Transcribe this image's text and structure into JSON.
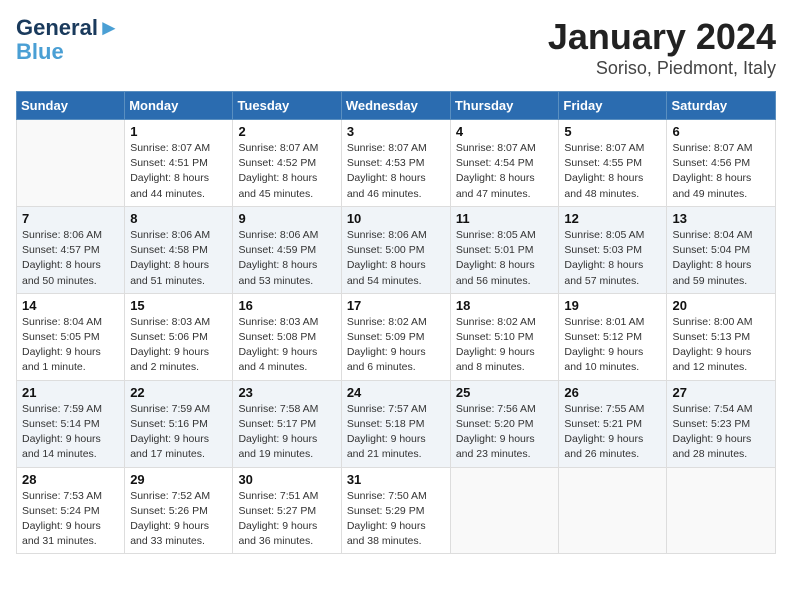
{
  "header": {
    "logo_line1": "General",
    "logo_line2": "Blue",
    "title": "January 2024",
    "subtitle": "Soriso, Piedmont, Italy"
  },
  "weekdays": [
    "Sunday",
    "Monday",
    "Tuesday",
    "Wednesday",
    "Thursday",
    "Friday",
    "Saturday"
  ],
  "weeks": [
    [
      {
        "day": "",
        "info": ""
      },
      {
        "day": "1",
        "info": "Sunrise: 8:07 AM\nSunset: 4:51 PM\nDaylight: 8 hours\nand 44 minutes."
      },
      {
        "day": "2",
        "info": "Sunrise: 8:07 AM\nSunset: 4:52 PM\nDaylight: 8 hours\nand 45 minutes."
      },
      {
        "day": "3",
        "info": "Sunrise: 8:07 AM\nSunset: 4:53 PM\nDaylight: 8 hours\nand 46 minutes."
      },
      {
        "day": "4",
        "info": "Sunrise: 8:07 AM\nSunset: 4:54 PM\nDaylight: 8 hours\nand 47 minutes."
      },
      {
        "day": "5",
        "info": "Sunrise: 8:07 AM\nSunset: 4:55 PM\nDaylight: 8 hours\nand 48 minutes."
      },
      {
        "day": "6",
        "info": "Sunrise: 8:07 AM\nSunset: 4:56 PM\nDaylight: 8 hours\nand 49 minutes."
      }
    ],
    [
      {
        "day": "7",
        "info": "Sunrise: 8:06 AM\nSunset: 4:57 PM\nDaylight: 8 hours\nand 50 minutes."
      },
      {
        "day": "8",
        "info": "Sunrise: 8:06 AM\nSunset: 4:58 PM\nDaylight: 8 hours\nand 51 minutes."
      },
      {
        "day": "9",
        "info": "Sunrise: 8:06 AM\nSunset: 4:59 PM\nDaylight: 8 hours\nand 53 minutes."
      },
      {
        "day": "10",
        "info": "Sunrise: 8:06 AM\nSunset: 5:00 PM\nDaylight: 8 hours\nand 54 minutes."
      },
      {
        "day": "11",
        "info": "Sunrise: 8:05 AM\nSunset: 5:01 PM\nDaylight: 8 hours\nand 56 minutes."
      },
      {
        "day": "12",
        "info": "Sunrise: 8:05 AM\nSunset: 5:03 PM\nDaylight: 8 hours\nand 57 minutes."
      },
      {
        "day": "13",
        "info": "Sunrise: 8:04 AM\nSunset: 5:04 PM\nDaylight: 8 hours\nand 59 minutes."
      }
    ],
    [
      {
        "day": "14",
        "info": "Sunrise: 8:04 AM\nSunset: 5:05 PM\nDaylight: 9 hours\nand 1 minute."
      },
      {
        "day": "15",
        "info": "Sunrise: 8:03 AM\nSunset: 5:06 PM\nDaylight: 9 hours\nand 2 minutes."
      },
      {
        "day": "16",
        "info": "Sunrise: 8:03 AM\nSunset: 5:08 PM\nDaylight: 9 hours\nand 4 minutes."
      },
      {
        "day": "17",
        "info": "Sunrise: 8:02 AM\nSunset: 5:09 PM\nDaylight: 9 hours\nand 6 minutes."
      },
      {
        "day": "18",
        "info": "Sunrise: 8:02 AM\nSunset: 5:10 PM\nDaylight: 9 hours\nand 8 minutes."
      },
      {
        "day": "19",
        "info": "Sunrise: 8:01 AM\nSunset: 5:12 PM\nDaylight: 9 hours\nand 10 minutes."
      },
      {
        "day": "20",
        "info": "Sunrise: 8:00 AM\nSunset: 5:13 PM\nDaylight: 9 hours\nand 12 minutes."
      }
    ],
    [
      {
        "day": "21",
        "info": "Sunrise: 7:59 AM\nSunset: 5:14 PM\nDaylight: 9 hours\nand 14 minutes."
      },
      {
        "day": "22",
        "info": "Sunrise: 7:59 AM\nSunset: 5:16 PM\nDaylight: 9 hours\nand 17 minutes."
      },
      {
        "day": "23",
        "info": "Sunrise: 7:58 AM\nSunset: 5:17 PM\nDaylight: 9 hours\nand 19 minutes."
      },
      {
        "day": "24",
        "info": "Sunrise: 7:57 AM\nSunset: 5:18 PM\nDaylight: 9 hours\nand 21 minutes."
      },
      {
        "day": "25",
        "info": "Sunrise: 7:56 AM\nSunset: 5:20 PM\nDaylight: 9 hours\nand 23 minutes."
      },
      {
        "day": "26",
        "info": "Sunrise: 7:55 AM\nSunset: 5:21 PM\nDaylight: 9 hours\nand 26 minutes."
      },
      {
        "day": "27",
        "info": "Sunrise: 7:54 AM\nSunset: 5:23 PM\nDaylight: 9 hours\nand 28 minutes."
      }
    ],
    [
      {
        "day": "28",
        "info": "Sunrise: 7:53 AM\nSunset: 5:24 PM\nDaylight: 9 hours\nand 31 minutes."
      },
      {
        "day": "29",
        "info": "Sunrise: 7:52 AM\nSunset: 5:26 PM\nDaylight: 9 hours\nand 33 minutes."
      },
      {
        "day": "30",
        "info": "Sunrise: 7:51 AM\nSunset: 5:27 PM\nDaylight: 9 hours\nand 36 minutes."
      },
      {
        "day": "31",
        "info": "Sunrise: 7:50 AM\nSunset: 5:29 PM\nDaylight: 9 hours\nand 38 minutes."
      },
      {
        "day": "",
        "info": ""
      },
      {
        "day": "",
        "info": ""
      },
      {
        "day": "",
        "info": ""
      }
    ]
  ]
}
